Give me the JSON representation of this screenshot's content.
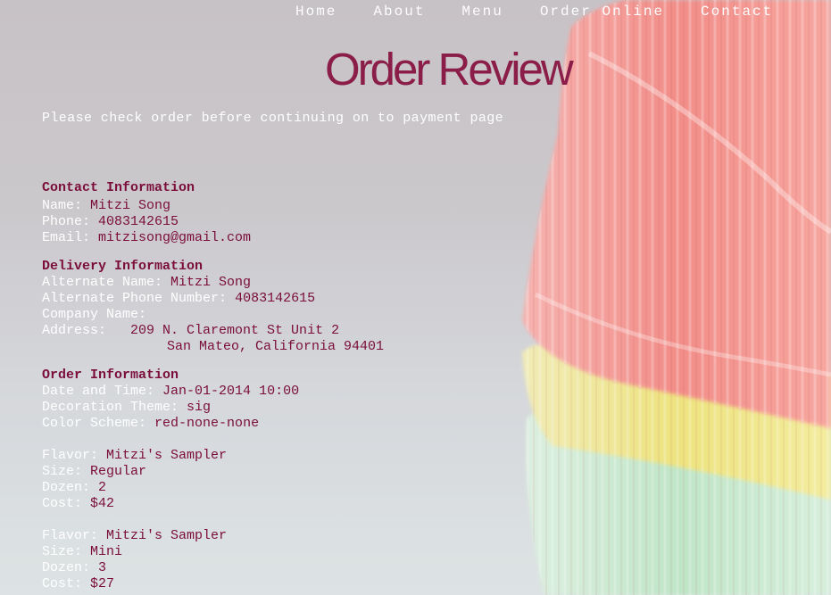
{
  "nav": {
    "items": [
      "Home",
      "About",
      "Menu",
      "Order Online",
      "Contact"
    ]
  },
  "page": {
    "title": "Order Review",
    "intro": "Please check order before continuing on to payment page"
  },
  "contact": {
    "heading": "Contact Information",
    "name_label": "Name:",
    "name": "Mitzi Song",
    "phone_label": "Phone:",
    "phone": "4083142615",
    "email_label": "Email:",
    "email": "mitzisong@gmail.com"
  },
  "delivery": {
    "heading": "Delivery Information",
    "alt_name_label": "Alternate Name:",
    "alt_name": "Mitzi Song",
    "alt_phone_label": "Alternate Phone Number:",
    "alt_phone": "4083142615",
    "company_label": "Company Name:",
    "company": "",
    "address_label": "Address:",
    "address_line1": "209 N. Claremont St Unit 2",
    "address_line2": "San Mateo, California 94401"
  },
  "order": {
    "heading": "Order Information",
    "datetime_label": "Date and Time:",
    "datetime": "Jan-01-2014 10:00",
    "theme_label": "Decoration Theme:",
    "theme": "sig",
    "scheme_label": "Color Scheme:",
    "scheme": "red-none-none",
    "items": [
      {
        "flavor_label": "Flavor:",
        "flavor": "Mitzi's Sampler",
        "size_label": "Size:",
        "size": "Regular",
        "dozen_label": "Dozen:",
        "dozen": "2",
        "cost_label": "Cost:",
        "cost": "$42"
      },
      {
        "flavor_label": "Flavor:",
        "flavor": "Mitzi's Sampler",
        "size_label": "Size:",
        "size": "Mini",
        "dozen_label": "Dozen:",
        "dozen": "3",
        "cost_label": "Cost:",
        "cost": "$27"
      }
    ]
  },
  "colors": {
    "accent": "#7a0d3a",
    "title": "#8b1d49",
    "liner_pink": "#f08a86",
    "liner_yellow": "#efe99a",
    "liner_green": "#c9e8cf"
  }
}
